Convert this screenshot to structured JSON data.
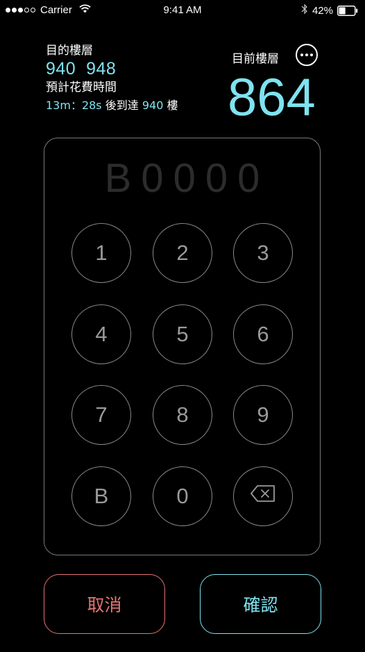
{
  "status_bar": {
    "signal_filled": 3,
    "signal_total": 5,
    "carrier": "Carrier",
    "time": "9:41 AM",
    "battery": "42%",
    "battery_level": 0.42
  },
  "target": {
    "label": "目的樓層",
    "floors": "940  948"
  },
  "eta": {
    "label": "預計花費時間",
    "duration": "13m：28s",
    "suffix": "後到達",
    "floor": "940",
    "unit": "樓"
  },
  "current": {
    "label": "目前樓層",
    "floor": "864"
  },
  "keypad": {
    "display": "B0000",
    "keys": [
      "1",
      "2",
      "3",
      "4",
      "5",
      "6",
      "7",
      "8",
      "9",
      "B",
      "0"
    ]
  },
  "actions": {
    "cancel": "取消",
    "confirm": "確認"
  },
  "colors": {
    "accent": "#7fe3f0",
    "cancel": "#e57373",
    "background": "#000000"
  },
  "icons": [
    "wifi-icon",
    "bluetooth-icon",
    "battery-icon",
    "more-icon",
    "backspace-icon"
  ]
}
